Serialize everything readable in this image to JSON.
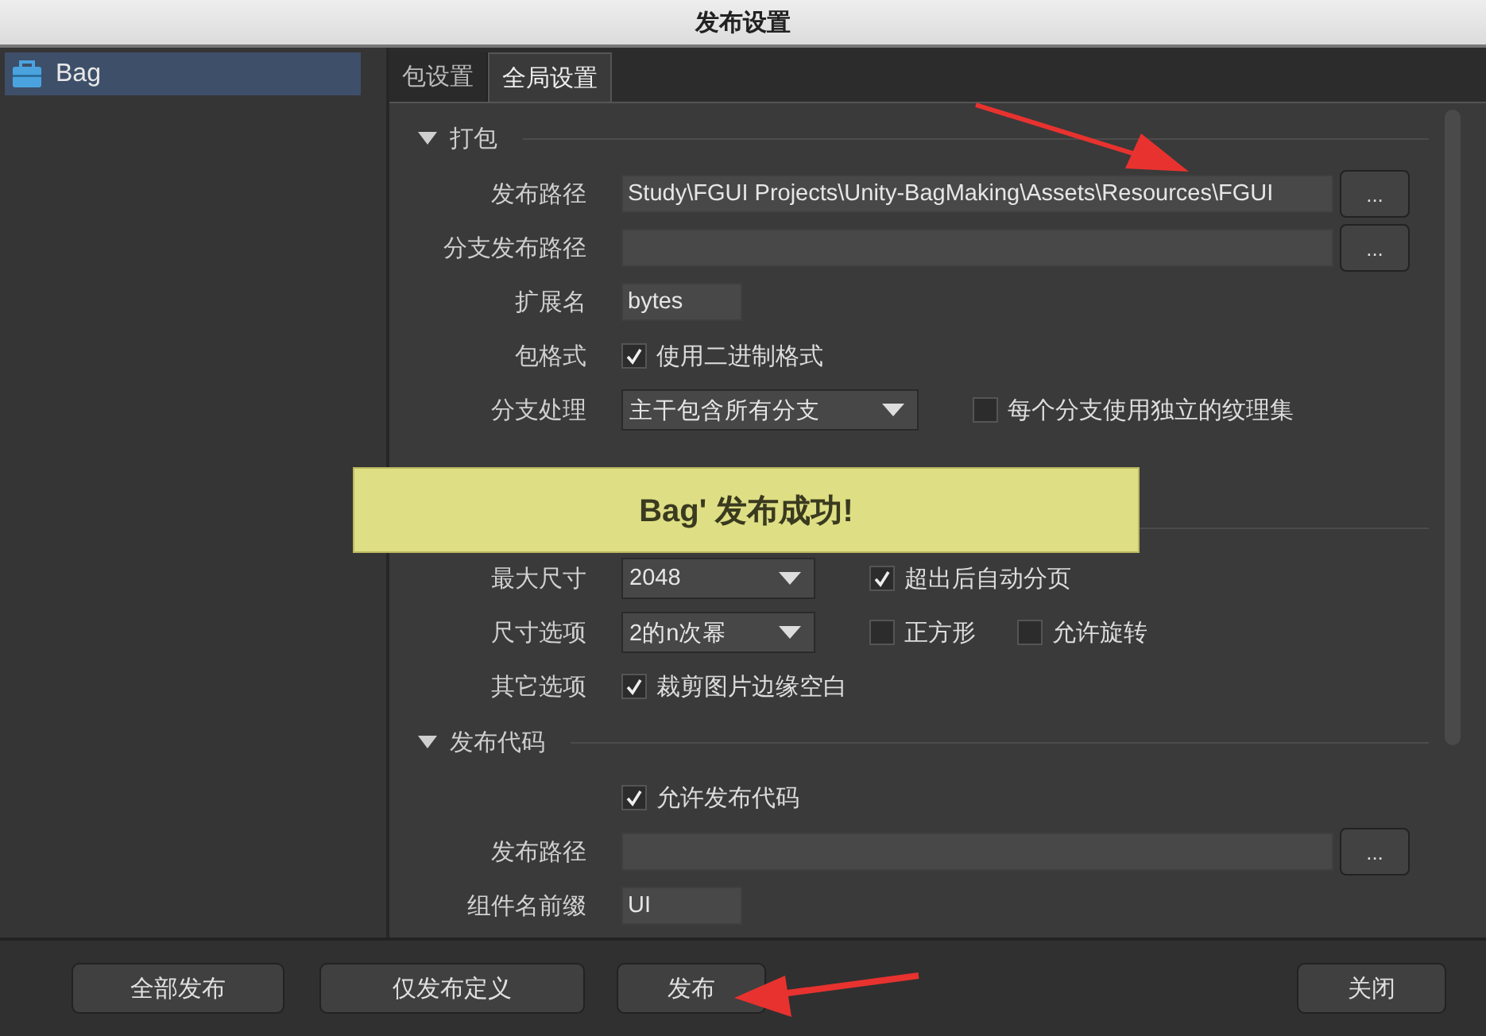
{
  "window": {
    "title": "发布设置"
  },
  "sidebar": {
    "items": [
      {
        "label": "Bag",
        "selected": true
      }
    ]
  },
  "tabs": [
    {
      "label": "包设置",
      "selected": false
    },
    {
      "label": "全局设置",
      "selected": true
    }
  ],
  "sections": [
    {
      "title": "打包",
      "expanded": true,
      "rows": [
        {
          "label": "发布路径",
          "controls": [
            {
              "kind": "path",
              "value": "Study\\FGUI  Projects\\Unity-BagMaking\\Assets\\Resources\\FGUI"
            },
            {
              "kind": "button",
              "label": "..."
            }
          ]
        },
        {
          "label": "分支发布路径",
          "controls": [
            {
              "kind": "path"
            },
            {
              "kind": "button",
              "label": "..."
            }
          ]
        },
        {
          "label": "扩展名",
          "controls": [
            {
              "kind": "input",
              "value": "bytes"
            }
          ]
        },
        {
          "label": "包格式",
          "controls": [
            {
              "kind": "checkbox",
              "label": "使用二进制格式",
              "checked": true
            }
          ]
        },
        {
          "label": "分支处理",
          "controls": [
            {
              "kind": "select",
              "value": "主干包含所有分支"
            },
            {
              "kind": "checkbox",
              "label": "每个分支使用独立的纹理集",
              "checked": false
            }
          ]
        }
      ]
    },
    {
      "expanded": true,
      "rows": [
        {
          "label": "最大尺寸",
          "controls": [
            {
              "kind": "select",
              "value": "2048"
            },
            {
              "kind": "checkbox",
              "label": "超出后自动分页",
              "checked": true
            }
          ]
        },
        {
          "label": "尺寸选项",
          "controls": [
            {
              "kind": "select",
              "value": "2的n次幂"
            },
            {
              "kind": "checkbox",
              "label": "正方形",
              "checked": false
            },
            {
              "kind": "checkbox",
              "label": "允许旋转",
              "checked": false
            }
          ]
        },
        {
          "label": "其它选项",
          "controls": [
            {
              "kind": "checkbox",
              "label": "裁剪图片边缘空白",
              "checked": true
            }
          ]
        }
      ]
    },
    {
      "title": "发布代码",
      "expanded": true,
      "rows": [
        {
          "label": "",
          "controls": [
            {
              "kind": "checkbox",
              "label": "允许发布代码",
              "checked": true
            }
          ]
        },
        {
          "label": "发布路径",
          "controls": [
            {
              "kind": "path"
            },
            {
              "kind": "button",
              "label": "..."
            }
          ]
        },
        {
          "label": "组件名前缀",
          "controls": [
            {
              "kind": "input",
              "value": "UI"
            }
          ]
        }
      ]
    }
  ],
  "toast": {
    "message": "Bag' 发布成功!"
  },
  "footer": {
    "buttons": [
      {
        "label": "全部发布"
      },
      {
        "label": "仅发布定义"
      },
      {
        "label": "发布"
      },
      {
        "label": "关闭"
      }
    ]
  }
}
